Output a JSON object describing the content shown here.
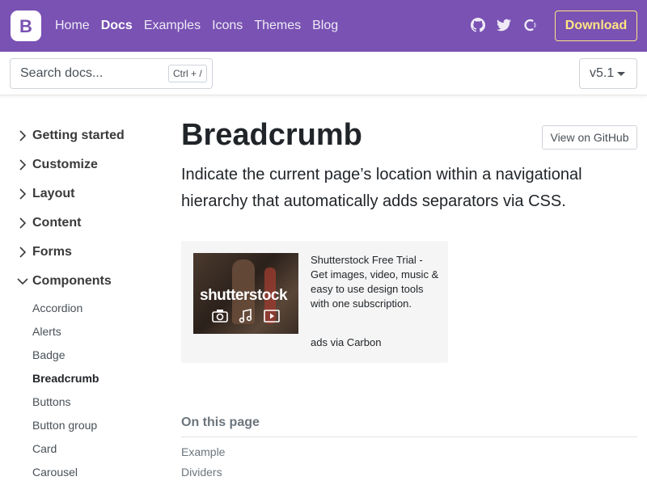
{
  "navbar": {
    "brand_letter": "B",
    "links": [
      {
        "label": "Home"
      },
      {
        "label": "Docs",
        "active": true
      },
      {
        "label": "Examples"
      },
      {
        "label": "Icons"
      },
      {
        "label": "Themes"
      },
      {
        "label": "Blog"
      }
    ],
    "icons": [
      "github-icon",
      "twitter-icon",
      "opencollective-icon"
    ],
    "download_label": "Download",
    "background_color": "#7952b3",
    "download_color": "#ffe484"
  },
  "subnav": {
    "search_placeholder": "Search docs...",
    "search_shortcut": "Ctrl + /",
    "version": "v5.1"
  },
  "sidebar": {
    "sections": [
      {
        "label": "Getting started",
        "expanded": false
      },
      {
        "label": "Customize",
        "expanded": false
      },
      {
        "label": "Layout",
        "expanded": false
      },
      {
        "label": "Content",
        "expanded": false
      },
      {
        "label": "Forms",
        "expanded": false
      },
      {
        "label": "Components",
        "expanded": true
      }
    ],
    "components_items": [
      {
        "label": "Accordion"
      },
      {
        "label": "Alerts"
      },
      {
        "label": "Badge"
      },
      {
        "label": "Breadcrumb",
        "active": true
      },
      {
        "label": "Buttons"
      },
      {
        "label": "Button group"
      },
      {
        "label": "Card"
      },
      {
        "label": "Carousel"
      }
    ]
  },
  "main": {
    "title": "Breadcrumb",
    "github_button": "View on GitHub",
    "lead": "Indicate the current page’s location within a navigational hierarchy that automatically adds separators via CSS."
  },
  "ad": {
    "logo_text": "shutterstock",
    "text": "Shutterstock Free Trial - Get images, video, music & easy to use design tools with one subscription.",
    "via": "ads via Carbon",
    "icons": [
      "camera-icon",
      "music-note-icon",
      "play-icon"
    ]
  },
  "toc": {
    "heading": "On this page",
    "items": [
      "Example",
      "Dividers"
    ]
  }
}
